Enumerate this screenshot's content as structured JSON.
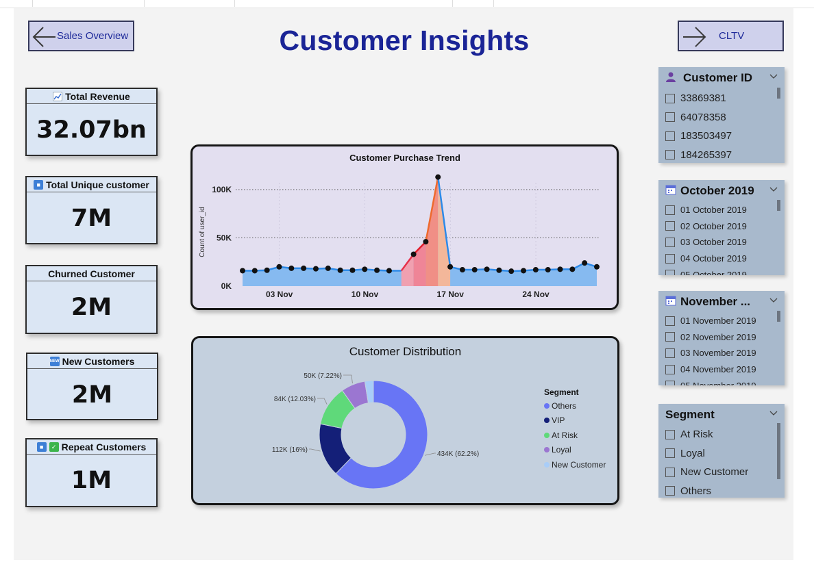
{
  "page": {
    "title": "Customer Insights"
  },
  "nav": {
    "back_label": "Sales Overview",
    "forward_label": "CLTV"
  },
  "kpis": [
    {
      "title": "Total Revenue",
      "value": "32.07bn",
      "icon": "chart-up-icon"
    },
    {
      "title": "Total Unique customer",
      "value": "7M",
      "icon": "people-icon"
    },
    {
      "title": "Churned Customer",
      "value": "2M",
      "icon": ""
    },
    {
      "title": "New Customers",
      "value": "2M",
      "icon": "new-badge-icon"
    },
    {
      "title": "Repeat Customers",
      "value": "1M",
      "icon": "check-icon"
    }
  ],
  "trend_chart": {
    "title": "Customer Purchase Trend",
    "ylabel": "Count of user_id",
    "y_ticks": [
      "100K",
      "50K",
      "0K"
    ],
    "x_ticks": [
      "03 Nov",
      "10 Nov",
      "17 Nov",
      "24 Nov"
    ]
  },
  "donut_chart": {
    "title": "Customer Distribution",
    "legend_title": "Segment",
    "labels": [
      "434K (62.2%)",
      "112K (16%)",
      "84K (12.03%)",
      "50K (7.22%)"
    ]
  },
  "chart_data": [
    {
      "type": "area",
      "title": "Customer Purchase Trend",
      "xlabel": "",
      "ylabel": "Count of user_id",
      "x": [
        "01 Nov",
        "02 Nov",
        "03 Nov",
        "04 Nov",
        "05 Nov",
        "06 Nov",
        "07 Nov",
        "08 Nov",
        "09 Nov",
        "10 Nov",
        "11 Nov",
        "12 Nov",
        "13 Nov",
        "14 Nov",
        "15 Nov",
        "16 Nov",
        "17 Nov",
        "18 Nov",
        "19 Nov",
        "20 Nov",
        "21 Nov",
        "22 Nov",
        "23 Nov",
        "24 Nov",
        "25 Nov",
        "26 Nov",
        "27 Nov",
        "28 Nov",
        "29 Nov",
        "30 Nov"
      ],
      "series": [
        {
          "values": [
            16000,
            16000,
            16500,
            20000,
            18500,
            18500,
            18000,
            18500,
            16500,
            16500,
            17500,
            16500,
            16000,
            16000,
            33000,
            46000,
            113000,
            20000,
            17000,
            17000,
            17500,
            16500,
            15500,
            16000,
            17000,
            17000,
            17500,
            17500,
            24000,
            20000
          ]
        }
      ],
      "ylim": [
        0,
        120000
      ],
      "grid": true
    },
    {
      "type": "pie",
      "title": "Customer Distribution",
      "legend_title": "Segment",
      "legend_position": "right",
      "categories": [
        "Others",
        "VIP",
        "At Risk",
        "Loyal",
        "New Customer"
      ],
      "values": [
        434,
        112,
        84,
        50,
        16
      ],
      "percent": [
        62.2,
        16,
        12.03,
        7.22,
        2.55
      ],
      "colors": [
        "#6875f5",
        "#141f78",
        "#5fd97a",
        "#9b76d1",
        "#a9cdf8"
      ]
    }
  ],
  "slicers": {
    "customer_id": {
      "title": "Customer ID",
      "items": [
        "33869381",
        "64078358",
        "183503497",
        "184265397"
      ]
    },
    "october": {
      "title": "October 2019",
      "items": [
        "01 October 2019",
        "02 October 2019",
        "03 October 2019",
        "04 October 2019",
        "05 October 2019"
      ]
    },
    "november": {
      "title": "November ...",
      "items": [
        "01 November 2019",
        "02 November 2019",
        "03 November 2019",
        "04 November 2019",
        "05 November 2019"
      ]
    },
    "segment": {
      "title": "Segment",
      "items": [
        "At Risk",
        "Loyal",
        "New Customer",
        "Others"
      ]
    }
  },
  "colors": {
    "title": "#1a2496",
    "kpi_bg": "#dbe6f4",
    "slicer_bg": "#a8b9cc",
    "trend_bg": "#e3dff0",
    "donut_bg": "#c4d0de"
  }
}
